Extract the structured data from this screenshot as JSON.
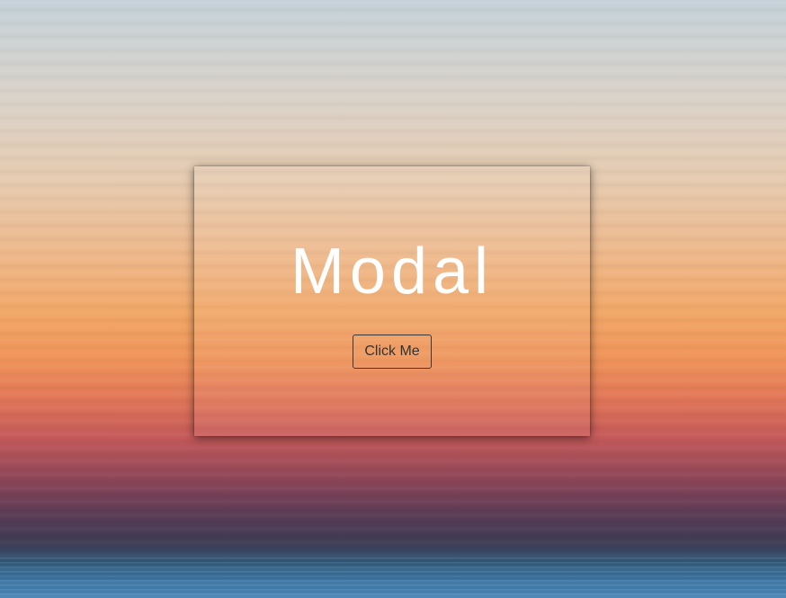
{
  "modal": {
    "title": "Modal",
    "button_label": "Click Me"
  },
  "colors": {
    "title_text": "#ffffff",
    "button_text": "#333333",
    "button_border": "#3a3a3a"
  }
}
